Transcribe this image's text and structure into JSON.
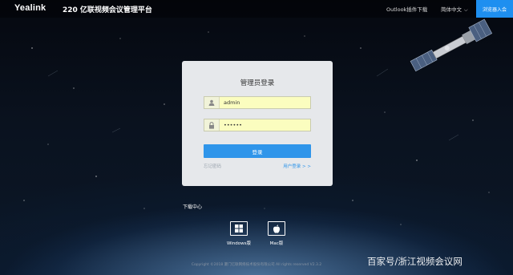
{
  "header": {
    "brand": "Yealink",
    "title": "220 亿联视频会议管理平台",
    "outlook_label": "Outlook插件下载",
    "language_label": "简体中文",
    "join_button": "浏览器入会"
  },
  "login": {
    "heading": "管理员登录",
    "username_value": "admin",
    "password_value": "••••••",
    "submit_label": "登录",
    "forgot_label": "忘记密码",
    "user_login_label": "用户登录 > >"
  },
  "downloads": {
    "title": "下载中心",
    "windows_label": "Windows版",
    "mac_label": "Mac版"
  },
  "footer": {
    "copyright": "Copyright ©2018 厦门亿联网络技术股份有限公司 All rights reserved  V2.3.2"
  },
  "watermark": "百家号/浙江视频会议网",
  "colors": {
    "accent": "#2f95ea",
    "input_bg": "#fbfdbf",
    "panel_bg": "#e6e8eb"
  },
  "icons": {
    "user": "user-icon",
    "lock": "lock-icon",
    "windows": "windows-icon",
    "apple": "apple-icon",
    "chevron": "chevron-down-icon"
  }
}
